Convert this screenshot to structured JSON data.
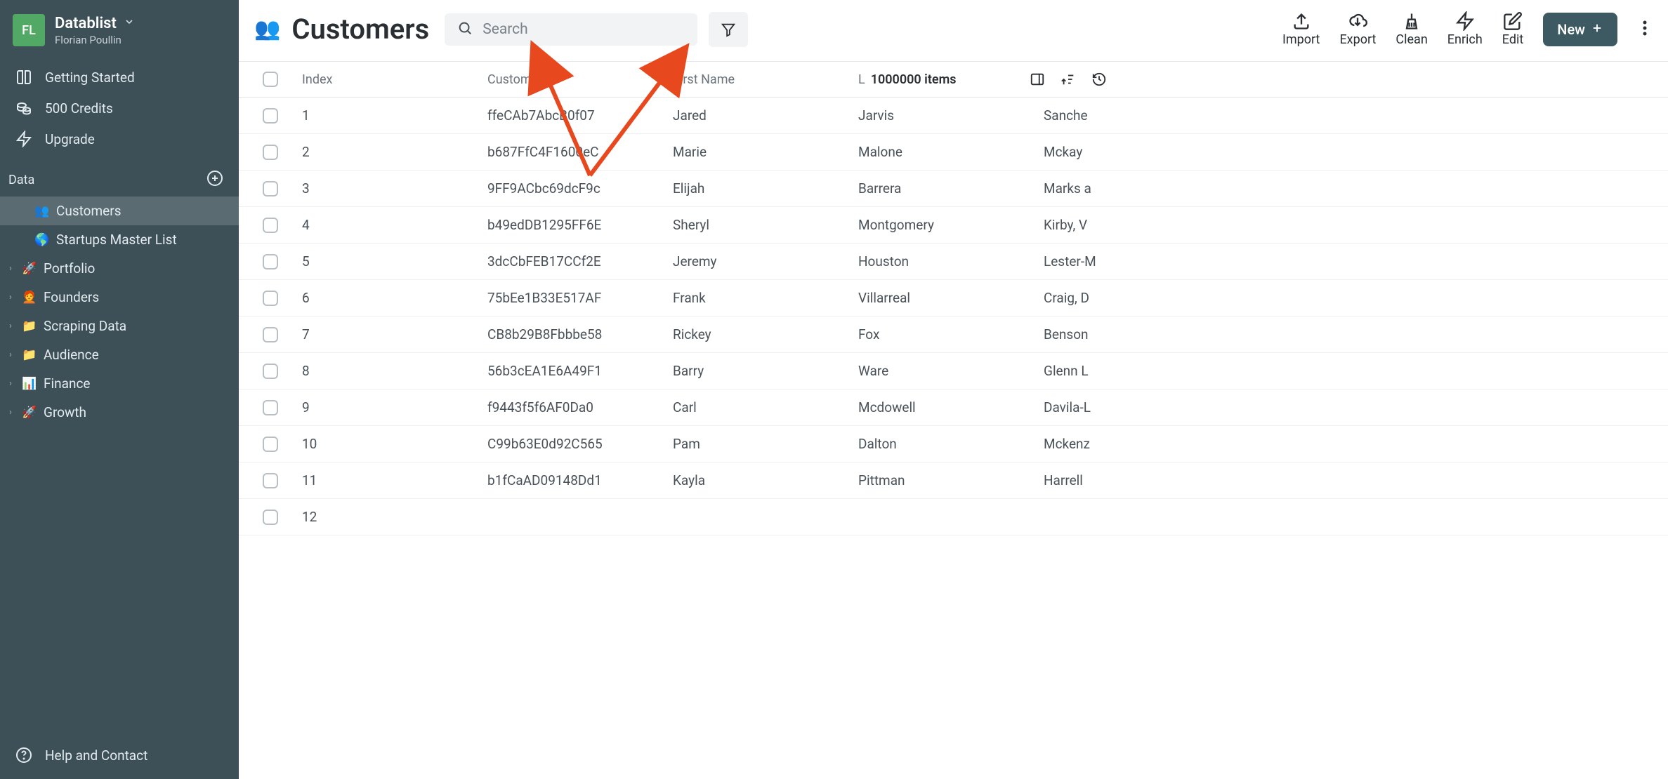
{
  "app": {
    "name": "Datablist",
    "user_initials": "FL",
    "user_name": "Florian Poullin"
  },
  "sidebar_top": [
    {
      "icon": "book",
      "label": "Getting Started"
    },
    {
      "icon": "coins",
      "label": "500 Credits"
    },
    {
      "icon": "bolt",
      "label": "Upgrade"
    }
  ],
  "data_section_title": "Data",
  "navigation": [
    {
      "emoji": "👥",
      "label": "Customers",
      "active": true,
      "caret": false,
      "indent": true
    },
    {
      "emoji": "🌎",
      "label": "Startups Master List",
      "active": false,
      "caret": false,
      "indent": true
    },
    {
      "emoji": "🚀",
      "label": "Portfolio",
      "active": false,
      "caret": true,
      "indent": false
    },
    {
      "emoji": "🧑‍🦰",
      "label": "Founders",
      "active": false,
      "caret": true,
      "indent": false
    },
    {
      "emoji": "📁",
      "label": "Scraping Data",
      "active": false,
      "caret": true,
      "indent": false
    },
    {
      "emoji": "📁",
      "label": "Audience",
      "active": false,
      "caret": true,
      "indent": false
    },
    {
      "emoji": "📊",
      "label": "Finance",
      "active": false,
      "caret": true,
      "indent": false
    },
    {
      "emoji": "🚀",
      "label": "Growth",
      "active": false,
      "caret": true,
      "indent": false
    }
  ],
  "help_label": "Help and Contact",
  "page": {
    "icon": "👥",
    "title": "Customers"
  },
  "search": {
    "placeholder": "Search"
  },
  "toolbar": {
    "import": "Import",
    "export": "Export",
    "clean": "Clean",
    "enrich": "Enrich",
    "edit": "Edit",
    "new": "New"
  },
  "columns": {
    "index": "Index",
    "customer_id": "Customer Id",
    "first_name": "First Name",
    "last_prefix": "L",
    "items_count": "1000000 items"
  },
  "rows": [
    {
      "index": "1",
      "cid": "ffeCAb7AbcB0f07",
      "fn": "Jared",
      "ln": "Jarvis",
      "extra": "Sanche"
    },
    {
      "index": "2",
      "cid": "b687FfC4F1600eC",
      "fn": "Marie",
      "ln": "Malone",
      "extra": "Mckay"
    },
    {
      "index": "3",
      "cid": "9FF9ACbc69dcF9c",
      "fn": "Elijah",
      "ln": "Barrera",
      "extra": "Marks a"
    },
    {
      "index": "4",
      "cid": "b49edDB1295FF6E",
      "fn": "Sheryl",
      "ln": "Montgomery",
      "extra": "Kirby, V"
    },
    {
      "index": "5",
      "cid": "3dcCbFEB17CCf2E",
      "fn": "Jeremy",
      "ln": "Houston",
      "extra": "Lester-M"
    },
    {
      "index": "6",
      "cid": "75bEe1B33E517AF",
      "fn": "Frank",
      "ln": "Villarreal",
      "extra": "Craig, D"
    },
    {
      "index": "7",
      "cid": "CB8b29B8Fbbbe58",
      "fn": "Rickey",
      "ln": "Fox",
      "extra": "Benson"
    },
    {
      "index": "8",
      "cid": "56b3cEA1E6A49F1",
      "fn": "Barry",
      "ln": "Ware",
      "extra": "Glenn L"
    },
    {
      "index": "9",
      "cid": "f9443f5f6AF0Da0",
      "fn": "Carl",
      "ln": "Mcdowell",
      "extra": "Davila-L"
    },
    {
      "index": "10",
      "cid": "C99b63E0d92C565",
      "fn": "Pam",
      "ln": "Dalton",
      "extra": "Mckenz"
    },
    {
      "index": "11",
      "cid": "b1fCaAD09148Dd1",
      "fn": "Kayla",
      "ln": "Pittman",
      "extra": "Harrell"
    },
    {
      "index": "12",
      "cid": "",
      "fn": "",
      "ln": "",
      "extra": ""
    }
  ]
}
